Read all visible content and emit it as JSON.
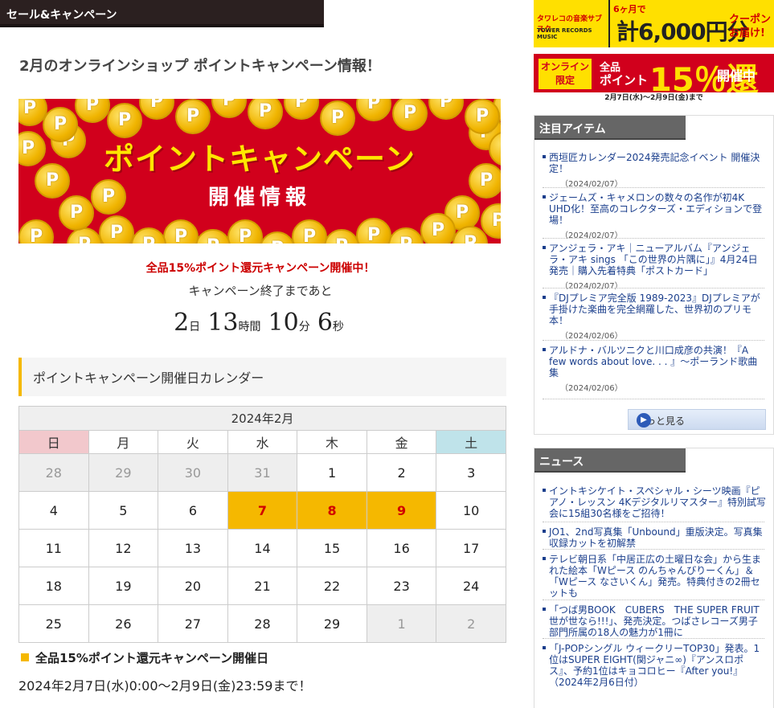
{
  "category": "セール&キャンペーン",
  "page_title": "2月のオンラインショップ ポイントキャンペーン情報！",
  "banner": {
    "title": "ポイントキャンペーン",
    "subtitle": "開催情報",
    "coin_letter": "P"
  },
  "campaign_note": "全品15%ポイント還元キャンペーン開催中！",
  "countdown": {
    "label": "キャンペーン終了まであと",
    "days": "2",
    "days_unit": "日",
    "hours": "13",
    "hours_unit": "時間",
    "minutes": "10",
    "minutes_unit": "分",
    "seconds": "6",
    "seconds_unit": "秒"
  },
  "calendar": {
    "heading": "ポイントキャンペーン開催日カレンダー",
    "month": "2024年2月",
    "weekdays": [
      "日",
      "月",
      "火",
      "水",
      "木",
      "金",
      "土"
    ],
    "weeks": [
      [
        {
          "d": "28",
          "s": "other"
        },
        {
          "d": "29",
          "s": "other"
        },
        {
          "d": "30",
          "s": "other"
        },
        {
          "d": "31",
          "s": "other"
        },
        {
          "d": "1",
          "s": ""
        },
        {
          "d": "2",
          "s": ""
        },
        {
          "d": "3",
          "s": ""
        }
      ],
      [
        {
          "d": "4",
          "s": ""
        },
        {
          "d": "5",
          "s": ""
        },
        {
          "d": "6",
          "s": ""
        },
        {
          "d": "7",
          "s": "hl"
        },
        {
          "d": "8",
          "s": "hl"
        },
        {
          "d": "9",
          "s": "hl"
        },
        {
          "d": "10",
          "s": ""
        }
      ],
      [
        {
          "d": "11",
          "s": ""
        },
        {
          "d": "12",
          "s": ""
        },
        {
          "d": "13",
          "s": ""
        },
        {
          "d": "14",
          "s": ""
        },
        {
          "d": "15",
          "s": ""
        },
        {
          "d": "16",
          "s": ""
        },
        {
          "d": "17",
          "s": ""
        }
      ],
      [
        {
          "d": "18",
          "s": ""
        },
        {
          "d": "19",
          "s": ""
        },
        {
          "d": "20",
          "s": ""
        },
        {
          "d": "21",
          "s": ""
        },
        {
          "d": "22",
          "s": ""
        },
        {
          "d": "23",
          "s": ""
        },
        {
          "d": "24",
          "s": ""
        }
      ],
      [
        {
          "d": "25",
          "s": ""
        },
        {
          "d": "26",
          "s": ""
        },
        {
          "d": "27",
          "s": ""
        },
        {
          "d": "28",
          "s": ""
        },
        {
          "d": "29",
          "s": ""
        },
        {
          "d": "1",
          "s": "other"
        },
        {
          "d": "2",
          "s": "other"
        }
      ]
    ]
  },
  "period": {
    "title": "全品15%ポイント還元キャンペーン開催日",
    "text": "2024年2月7日(水)0:00～2月9日(金)23:59まで！"
  },
  "ads": {
    "tower": {
      "name": "タワレコの音楽サブスク",
      "sub": "TOWER RECORDS MUSIC",
      "months": "6ヶ月で",
      "amount": "計6,000円分",
      "coupon": "クーポン お届け!"
    },
    "online": {
      "badge": "オンライン 限定",
      "line1": "全品",
      "line2": "ポイント",
      "percent": "15％還元",
      "status": "開催中",
      "dates": "2月7日(水)～2月9日(金)まで"
    }
  },
  "featured": {
    "title": "注目アイテム",
    "items": [
      {
        "text": "西垣匠カレンダー2024発売記念イベント 開催決定！",
        "date": "（2024/02/07）"
      },
      {
        "text": "ジェームズ・キャメロンの数々の名作が初4K UHD化！至高のコレクターズ・エディションで登場！",
        "date": "（2024/02/07）"
      },
      {
        "text": "アンジェラ・アキ｜ニューアルバム『アンジェラ・アキ sings 「この世界の片隅に」』4月24日発売｜購入先着特典「ポストカード」",
        "date": "（2024/02/07）"
      },
      {
        "text": "『DJプレミア完全版 1989-2023』DJプレミアが手掛けた楽曲を完全網羅した、世界初のプリモ本！",
        "date": "（2024/02/06）"
      },
      {
        "text": "アルドナ・バルツニクと川口成彦の共演！『A few words about love. . . 』～ポーランド歌曲集",
        "date": "（2024/02/06）"
      }
    ],
    "more": "もっと見る"
  },
  "news": {
    "title": "ニュース",
    "items": [
      {
        "text": "イントキシケイト・スペシャル・シーツ映画『ピアノ・レッスン 4Kデジタルリマスター』特別試写会に15組30名様をご招待！"
      },
      {
        "text": "JO1、2nd写真集「Unbound」重版決定。写真集収録カットを初解禁"
      },
      {
        "text": "テレビ朝日系「中居正広の土曜日な会」から生まれた絵本「Wピース のんちゃんびりーくん」＆「Wピース なさいくん」発売。特典付きの2冊セットも"
      },
      {
        "text": "「つば男BOOK　CUBERS　THE SUPER FRUIT 世が世なら!!!」、発売決定。つばさレコーズ男子部門所属の18人の魅力が1冊に"
      },
      {
        "text": "「J-POPシングル ウィークリーTOP30」発表。1位はSUPER EIGHT(関ジャニ∞)『アンスロポス』、予約1位はキョコロヒー『After you!』（2024年2月6日付）"
      }
    ]
  }
}
